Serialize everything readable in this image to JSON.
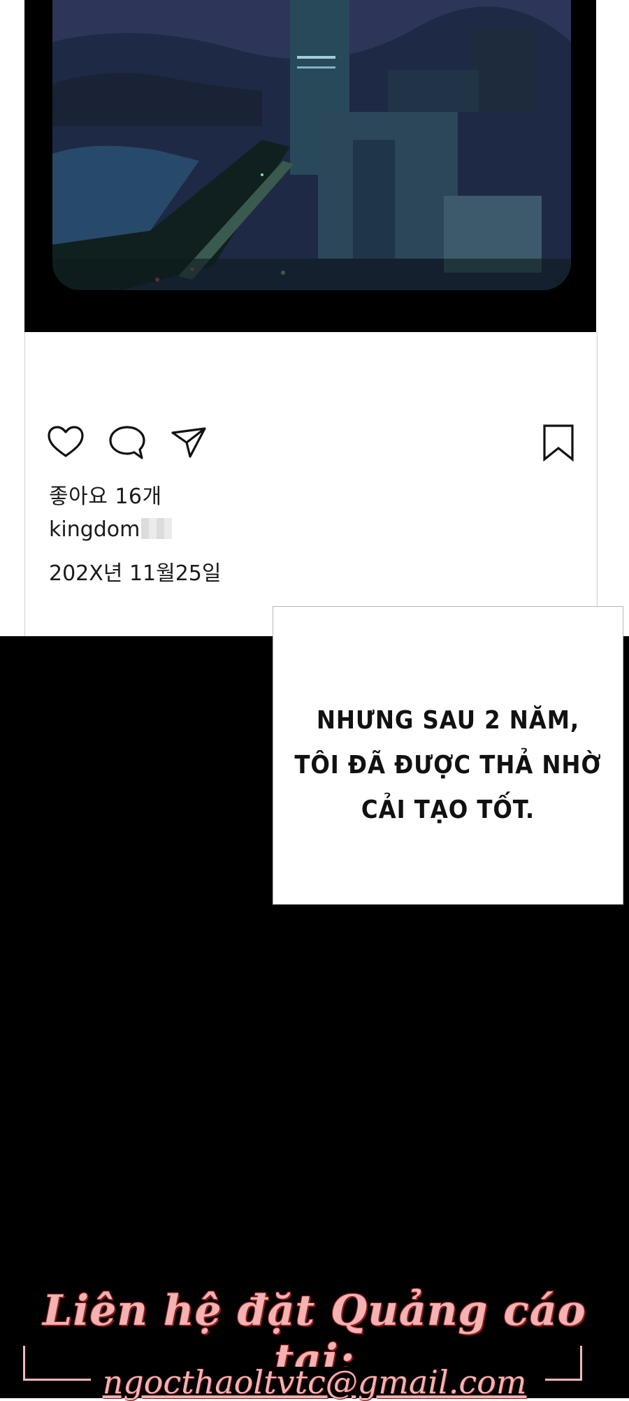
{
  "post": {
    "likes": "좋아요 16개",
    "username": "kingdom",
    "date": "202X년 11월25일"
  },
  "icons": {
    "like": "heart-icon",
    "comment": "speech-bubble-icon",
    "share": "paper-plane-icon",
    "save": "bookmark-icon"
  },
  "caption": {
    "lines": [
      "NHƯNG SAU 2 NĂM,",
      "TÔI ĐÃ ĐƯỢC THẢ NHỜ",
      "CẢI TẠO TỐT."
    ]
  },
  "ad": {
    "heading": "Liên hệ đặt Quảng cáo tại:",
    "email": "ngocthaoltvtc@gmail.com"
  }
}
